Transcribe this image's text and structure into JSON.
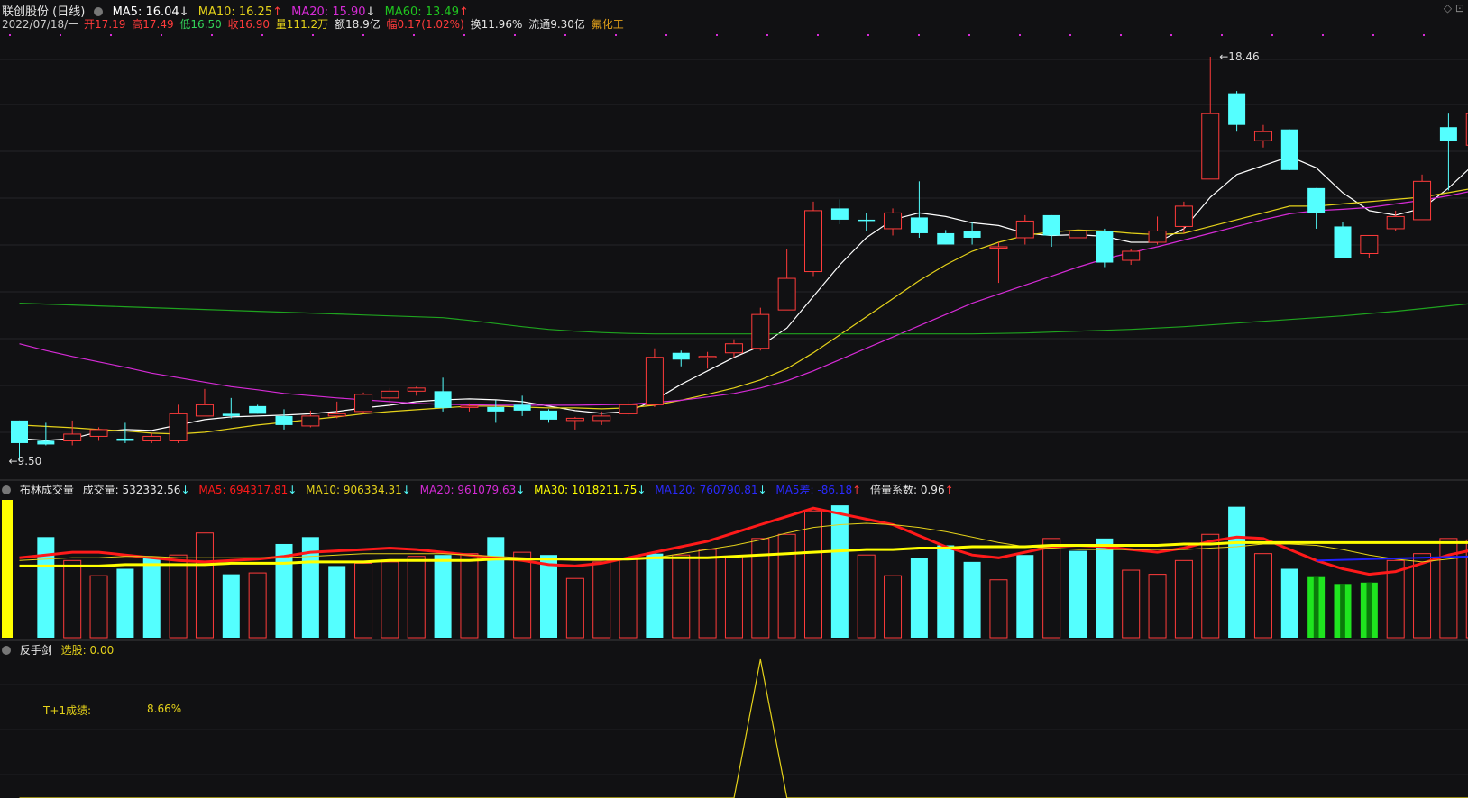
{
  "header": {
    "stock": "联创股份 (日线)",
    "ma5": "MA5: 16.04",
    "ma5_arrow": "↓",
    "ma10": "MA10: 16.25",
    "ma10_arrow": "↑",
    "ma20": "MA20: 15.90",
    "ma20_arrow": "↓",
    "ma60": "MA60: 13.49",
    "ma60_arrow": "↑"
  },
  "quote": {
    "date": "2022/07/18/一",
    "open": "开17.19",
    "high": "高17.49",
    "low": "低16.50",
    "close": "收16.90",
    "vol": "量111.2万",
    "amount": "额18.9亿",
    "change": "幅0.17(1.02%)",
    "turnover": "换11.96%",
    "float": "流通9.30亿",
    "sector": "氟化工"
  },
  "vol_header": {
    "name": "布林成交量",
    "vol": "成交量: 532332.56",
    "vol_arrow": "↓",
    "ma5": "MA5: 694317.81",
    "ma5_arrow": "↓",
    "ma10": "MA10: 906334.31",
    "ma10_arrow": "↓",
    "ma20": "MA20: 961079.63",
    "ma20_arrow": "↓",
    "ma30": "MA30: 1018211.75",
    "ma30_arrow": "↓",
    "ma120": "MA120: 760790.81",
    "ma120_arrow": "↓",
    "ma5x": "MA5差: -86.18",
    "ma5x_arrow": "↑",
    "ratio": "倍量系数: 0.96",
    "ratio_arrow": "↑"
  },
  "ind_header": {
    "name": "反手剑",
    "pick": "选股: 0.00"
  },
  "annotation": {
    "label": "T+1成绩:",
    "value": "8.66%"
  },
  "colors": {
    "up": "#ff3b3b",
    "down": "#54ffff",
    "ma5": "#ffffff",
    "ma10": "#e5d21a",
    "ma20": "#d62bd6",
    "ma60": "#1fa31f",
    "vol_ma5": "#ff1a1a",
    "vol_ma30": "#ffff00",
    "vol_ma120": "#2020ff"
  },
  "chart_data": [
    {
      "type": "candlestick",
      "series_name": "联创股份 日线",
      "price_labels": {
        "high": "18.46",
        "low": "9.50"
      },
      "ylim": [
        9.5,
        18.8
      ],
      "candles": [
        {
          "o": 10.4,
          "h": 10.4,
          "l": 9.5,
          "c": 9.9
        },
        {
          "o": 9.95,
          "h": 10.35,
          "l": 9.85,
          "c": 9.87
        },
        {
          "o": 9.95,
          "h": 10.4,
          "l": 9.85,
          "c": 10.1
        },
        {
          "o": 10.05,
          "h": 10.25,
          "l": 9.95,
          "c": 10.2
        },
        {
          "o": 10.0,
          "h": 10.35,
          "l": 9.9,
          "c": 9.95
        },
        {
          "o": 9.95,
          "h": 10.12,
          "l": 9.9,
          "c": 10.05
        },
        {
          "o": 9.95,
          "h": 10.75,
          "l": 9.9,
          "c": 10.55
        },
        {
          "o": 10.5,
          "h": 11.1,
          "l": 10.5,
          "c": 10.75
        },
        {
          "o": 10.55,
          "h": 10.9,
          "l": 10.45,
          "c": 10.5
        },
        {
          "o": 10.72,
          "h": 10.75,
          "l": 10.55,
          "c": 10.55
        },
        {
          "o": 10.5,
          "h": 10.65,
          "l": 10.2,
          "c": 10.3
        },
        {
          "o": 10.28,
          "h": 10.62,
          "l": 10.25,
          "c": 10.5
        },
        {
          "o": 10.5,
          "h": 10.82,
          "l": 10.45,
          "c": 10.55
        },
        {
          "o": 10.6,
          "h": 11.02,
          "l": 10.55,
          "c": 10.98
        },
        {
          "o": 10.9,
          "h": 11.12,
          "l": 10.7,
          "c": 11.05
        },
        {
          "o": 11.05,
          "h": 11.15,
          "l": 10.95,
          "c": 11.12
        },
        {
          "o": 11.05,
          "h": 11.35,
          "l": 10.6,
          "c": 10.68
        },
        {
          "o": 10.7,
          "h": 10.78,
          "l": 10.6,
          "c": 10.72
        },
        {
          "o": 10.7,
          "h": 10.85,
          "l": 10.35,
          "c": 10.6
        },
        {
          "o": 10.75,
          "h": 10.95,
          "l": 10.5,
          "c": 10.62
        },
        {
          "o": 10.62,
          "h": 10.65,
          "l": 10.35,
          "c": 10.42
        },
        {
          "o": 10.4,
          "h": 10.48,
          "l": 10.2,
          "c": 10.45
        },
        {
          "o": 10.4,
          "h": 10.6,
          "l": 10.3,
          "c": 10.5
        },
        {
          "o": 10.55,
          "h": 10.85,
          "l": 10.5,
          "c": 10.75
        },
        {
          "o": 10.75,
          "h": 12.0,
          "l": 10.7,
          "c": 11.8
        },
        {
          "o": 11.9,
          "h": 11.95,
          "l": 11.6,
          "c": 11.75
        },
        {
          "o": 11.8,
          "h": 11.92,
          "l": 11.55,
          "c": 11.82
        },
        {
          "o": 11.9,
          "h": 12.2,
          "l": 11.8,
          "c": 12.1
        },
        {
          "o": 12.0,
          "h": 12.9,
          "l": 11.95,
          "c": 12.75
        },
        {
          "o": 12.85,
          "h": 14.2,
          "l": 12.85,
          "c": 13.55
        },
        {
          "o": 13.7,
          "h": 15.25,
          "l": 13.6,
          "c": 15.05
        },
        {
          "o": 15.1,
          "h": 15.3,
          "l": 14.75,
          "c": 14.85
        },
        {
          "o": 14.85,
          "h": 15.0,
          "l": 14.6,
          "c": 14.82
        },
        {
          "o": 14.65,
          "h": 15.1,
          "l": 14.5,
          "c": 15.0
        },
        {
          "o": 14.9,
          "h": 15.7,
          "l": 14.45,
          "c": 14.55
        },
        {
          "o": 14.55,
          "h": 14.62,
          "l": 14.3,
          "c": 14.3
        },
        {
          "o": 14.6,
          "h": 14.8,
          "l": 14.3,
          "c": 14.45
        },
        {
          "o": 14.25,
          "h": 14.35,
          "l": 13.45,
          "c": 14.25
        },
        {
          "o": 14.45,
          "h": 14.95,
          "l": 14.3,
          "c": 14.82
        },
        {
          "o": 14.95,
          "h": 14.95,
          "l": 14.25,
          "c": 14.5
        },
        {
          "o": 14.45,
          "h": 14.75,
          "l": 14.15,
          "c": 14.6
        },
        {
          "o": 14.6,
          "h": 14.65,
          "l": 13.8,
          "c": 13.9
        },
        {
          "o": 13.95,
          "h": 14.2,
          "l": 13.85,
          "c": 14.15
        },
        {
          "o": 14.35,
          "h": 14.92,
          "l": 14.3,
          "c": 14.6
        },
        {
          "o": 14.7,
          "h": 15.25,
          "l": 14.55,
          "c": 15.15
        },
        {
          "o": 15.75,
          "h": 18.46,
          "l": 15.75,
          "c": 17.2
        },
        {
          "o": 17.65,
          "h": 17.7,
          "l": 16.8,
          "c": 16.95
        },
        {
          "o": 16.6,
          "h": 16.95,
          "l": 16.45,
          "c": 16.8
        },
        {
          "o": 16.85,
          "h": 16.85,
          "l": 15.95,
          "c": 15.95
        },
        {
          "o": 15.55,
          "h": 15.55,
          "l": 14.65,
          "c": 15.0
        },
        {
          "o": 14.7,
          "h": 14.8,
          "l": 14.0,
          "c": 14.0
        },
        {
          "o": 14.1,
          "h": 14.5,
          "l": 14.0,
          "c": 14.5
        },
        {
          "o": 14.65,
          "h": 15.05,
          "l": 14.6,
          "c": 14.92
        },
        {
          "o": 14.85,
          "h": 15.85,
          "l": 14.85,
          "c": 15.7
        },
        {
          "o": 16.9,
          "h": 17.2,
          "l": 15.5,
          "c": 16.6
        },
        {
          "o": 16.5,
          "h": 17.7,
          "l": 16.5,
          "c": 17.2
        }
      ],
      "ma_series": [
        {
          "name": "MA5",
          "values": [
            10.0,
            9.96,
            10.0,
            10.15,
            10.2,
            10.18,
            10.3,
            10.42,
            10.48,
            10.5,
            10.52,
            10.55,
            10.6,
            10.68,
            10.74,
            10.82,
            10.86,
            10.88,
            10.86,
            10.82,
            10.72,
            10.62,
            10.56,
            10.6,
            10.85,
            11.2,
            11.5,
            11.8,
            12.05,
            12.45,
            13.15,
            13.85,
            14.45,
            14.85,
            15.0,
            14.92,
            14.78,
            14.72,
            14.55,
            14.5,
            14.52,
            14.48,
            14.35,
            14.35,
            14.65,
            15.35,
            15.85,
            16.05,
            16.25,
            16.0,
            15.45,
            15.05,
            14.95,
            15.1,
            15.55,
            16.1
          ]
        },
        {
          "name": "MA10",
          "values": [
            10.3,
            10.27,
            10.24,
            10.2,
            10.17,
            10.12,
            10.1,
            10.14,
            10.22,
            10.3,
            10.36,
            10.42,
            10.48,
            10.55,
            10.6,
            10.64,
            10.68,
            10.72,
            10.72,
            10.7,
            10.68,
            10.68,
            10.66,
            10.68,
            10.74,
            10.85,
            10.98,
            11.12,
            11.3,
            11.55,
            11.9,
            12.3,
            12.7,
            13.1,
            13.5,
            13.85,
            14.15,
            14.35,
            14.5,
            14.58,
            14.62,
            14.6,
            14.55,
            14.52,
            14.55,
            14.7,
            14.85,
            15.0,
            15.15,
            15.15,
            15.2,
            15.25,
            15.3,
            15.35,
            15.45,
            15.55
          ]
        },
        {
          "name": "MA20",
          "values": [
            12.1,
            11.95,
            11.82,
            11.7,
            11.58,
            11.45,
            11.35,
            11.25,
            11.15,
            11.08,
            11.0,
            10.95,
            10.9,
            10.86,
            10.82,
            10.78,
            10.76,
            10.75,
            10.74,
            10.74,
            10.74,
            10.74,
            10.75,
            10.76,
            10.8,
            10.85,
            10.92,
            11.0,
            11.12,
            11.28,
            11.5,
            11.75,
            12.0,
            12.25,
            12.5,
            12.75,
            13.0,
            13.2,
            13.4,
            13.6,
            13.8,
            13.98,
            14.12,
            14.25,
            14.4,
            14.55,
            14.7,
            14.85,
            14.98,
            15.05,
            15.08,
            15.12,
            15.2,
            15.28,
            15.38,
            15.5
          ]
        },
        {
          "name": "MA60",
          "values": [
            13.0,
            12.98,
            12.96,
            12.94,
            12.92,
            12.9,
            12.88,
            12.86,
            12.84,
            12.82,
            12.8,
            12.78,
            12.76,
            12.74,
            12.72,
            12.7,
            12.68,
            12.62,
            12.55,
            12.48,
            12.42,
            12.38,
            12.35,
            12.33,
            12.32,
            12.32,
            12.32,
            12.32,
            12.32,
            12.32,
            12.32,
            12.32,
            12.32,
            12.32,
            12.32,
            12.32,
            12.32,
            12.33,
            12.34,
            12.36,
            12.38,
            12.4,
            12.42,
            12.45,
            12.48,
            12.52,
            12.56,
            12.6,
            12.64,
            12.68,
            12.72,
            12.77,
            12.82,
            12.88,
            12.94,
            13.0
          ]
        }
      ]
    },
    {
      "type": "bar",
      "series_name": "成交量",
      "values": [
        100,
        73,
        56,
        45,
        50,
        58,
        60,
        76,
        46,
        47,
        68,
        73,
        52,
        54,
        55,
        59,
        60,
        61,
        73,
        62,
        60,
        43,
        55,
        57,
        61,
        60,
        64,
        59,
        72,
        75,
        92,
        96,
        60,
        45,
        58,
        67,
        55,
        42,
        60,
        72,
        63,
        72,
        49,
        46,
        56,
        75,
        95,
        61,
        50,
        44,
        39,
        40,
        56,
        61,
        72,
        71
      ],
      "color_kind": [
        "up",
        "down",
        "up",
        "up",
        "down",
        "down",
        "up",
        "up",
        "down",
        "up",
        "down",
        "down",
        "down",
        "up",
        "up",
        "up",
        "down",
        "up",
        "down",
        "up",
        "down",
        "up",
        "up",
        "up",
        "down",
        "up",
        "up",
        "up",
        "up",
        "up",
        "up",
        "down",
        "up",
        "up",
        "down",
        "down",
        "down",
        "up",
        "down",
        "up",
        "down",
        "down",
        "up",
        "up",
        "up",
        "up",
        "down",
        "up",
        "down",
        "green",
        "green",
        "green",
        "up",
        "up",
        "up",
        "up"
      ],
      "ma_lines": [
        {
          "name": "MA5",
          "values": [
            58,
            60,
            62,
            62,
            60,
            58,
            56,
            55,
            56,
            57,
            59,
            62,
            63,
            64,
            65,
            64,
            62,
            60,
            58,
            56,
            53,
            52,
            54,
            58,
            62,
            66,
            70,
            76,
            82,
            88,
            94,
            90,
            86,
            82,
            74,
            66,
            60,
            58,
            62,
            66,
            67,
            66,
            64,
            62,
            65,
            70,
            73,
            72,
            64,
            56,
            50,
            46,
            48,
            54,
            60,
            64
          ]
        },
        {
          "name": "MA10",
          "values": [
            56,
            57,
            58,
            58,
            59,
            59,
            58,
            58,
            58,
            58,
            58,
            59,
            60,
            61,
            61,
            61,
            61,
            60,
            59,
            58,
            57,
            56,
            56,
            57,
            58,
            61,
            64,
            67,
            71,
            76,
            80,
            82,
            83,
            82,
            80,
            77,
            73,
            69,
            66,
            65,
            64,
            64,
            64,
            64,
            64,
            65,
            66,
            68,
            68,
            67,
            64,
            60,
            57,
            55,
            57,
            59
          ]
        },
        {
          "name": "MA30",
          "values": [
            52,
            52,
            52,
            52,
            53,
            53,
            53,
            53,
            54,
            54,
            54,
            55,
            55,
            55,
            56,
            56,
            56,
            56,
            57,
            57,
            57,
            57,
            57,
            57,
            58,
            58,
            58,
            59,
            60,
            61,
            62,
            63,
            64,
            64,
            65,
            65,
            66,
            66,
            66,
            67,
            67,
            67,
            67,
            67,
            68,
            68,
            69,
            69,
            69,
            69,
            69,
            69,
            69,
            69,
            69,
            69
          ]
        }
      ],
      "ma120_segment": {
        "start": 49,
        "end": 55,
        "from": 56,
        "to": 59
      }
    },
    {
      "type": "line",
      "series_name": "反手剑",
      "values": [
        0,
        0,
        0,
        0,
        0,
        0,
        0,
        0,
        0,
        0,
        0,
        0,
        0,
        0,
        0,
        0,
        0,
        0,
        0,
        0,
        0,
        0,
        0,
        0,
        0,
        0,
        0,
        0,
        1,
        0,
        0,
        0,
        0,
        0,
        0,
        0,
        0,
        0,
        0,
        0,
        0,
        0,
        0,
        0,
        0,
        0,
        0,
        0,
        0,
        0,
        0,
        0,
        0,
        0,
        0,
        0
      ]
    }
  ]
}
